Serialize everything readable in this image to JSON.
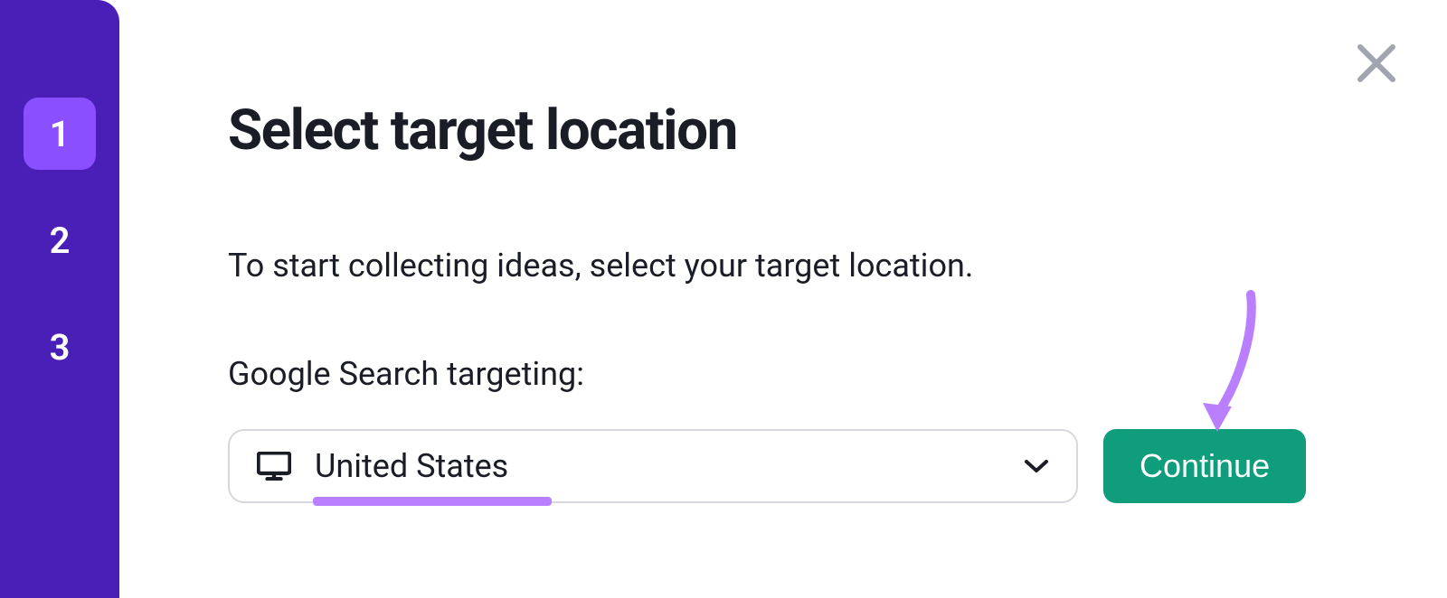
{
  "sidebar": {
    "steps": [
      {
        "label": "1",
        "active": true
      },
      {
        "label": "2",
        "active": false
      },
      {
        "label": "3",
        "active": false
      }
    ]
  },
  "main": {
    "title": "Select target location",
    "subtitle": "To start collecting ideas, select your target location.",
    "field_label": "Google Search targeting:",
    "location_select": {
      "value": "United States"
    },
    "continue_label": "Continue"
  },
  "colors": {
    "sidebar_bg": "#4a1fb8",
    "step_active_bg": "#8a4fff",
    "accent_green": "#0f9d7c",
    "annotation_purple": "#b97fff",
    "text_primary": "#1a1d26",
    "border_gray": "#d6d8dd",
    "close_gray": "#a1a5af"
  }
}
